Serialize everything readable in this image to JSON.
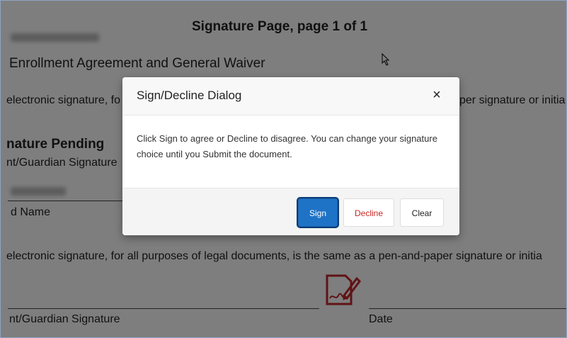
{
  "document": {
    "title": "Signature Page, page 1 of 1",
    "agreement_title": "Enrollment Agreement and General Waiver",
    "legal_notice_partial": "electronic signature, fo",
    "legal_notice_right": "per signature or initia",
    "signature_pending": "nature Pending",
    "guardian_signature_label_top": "nt/Guardian Signature",
    "printed_name_label": "d Name",
    "legal_notice_full": "electronic signature, for all purposes of legal documents, is the same as a pen-and-paper signature or initia",
    "guardian_signature_label": "nt/Guardian Signature",
    "date_label": "Date",
    "sign_icon": "signature-pen-icon",
    "sign_icon_color": "#c0272d"
  },
  "dialog": {
    "title": "Sign/Decline Dialog",
    "close_symbol": "×",
    "message": "Click Sign to agree or Decline to disagree. You can change your signature choice until you Submit the document.",
    "buttons": {
      "sign": "Sign",
      "decline": "Decline",
      "clear": "Clear"
    },
    "colors": {
      "sign_bg": "#1f73c7",
      "decline_text": "#c62828"
    }
  }
}
